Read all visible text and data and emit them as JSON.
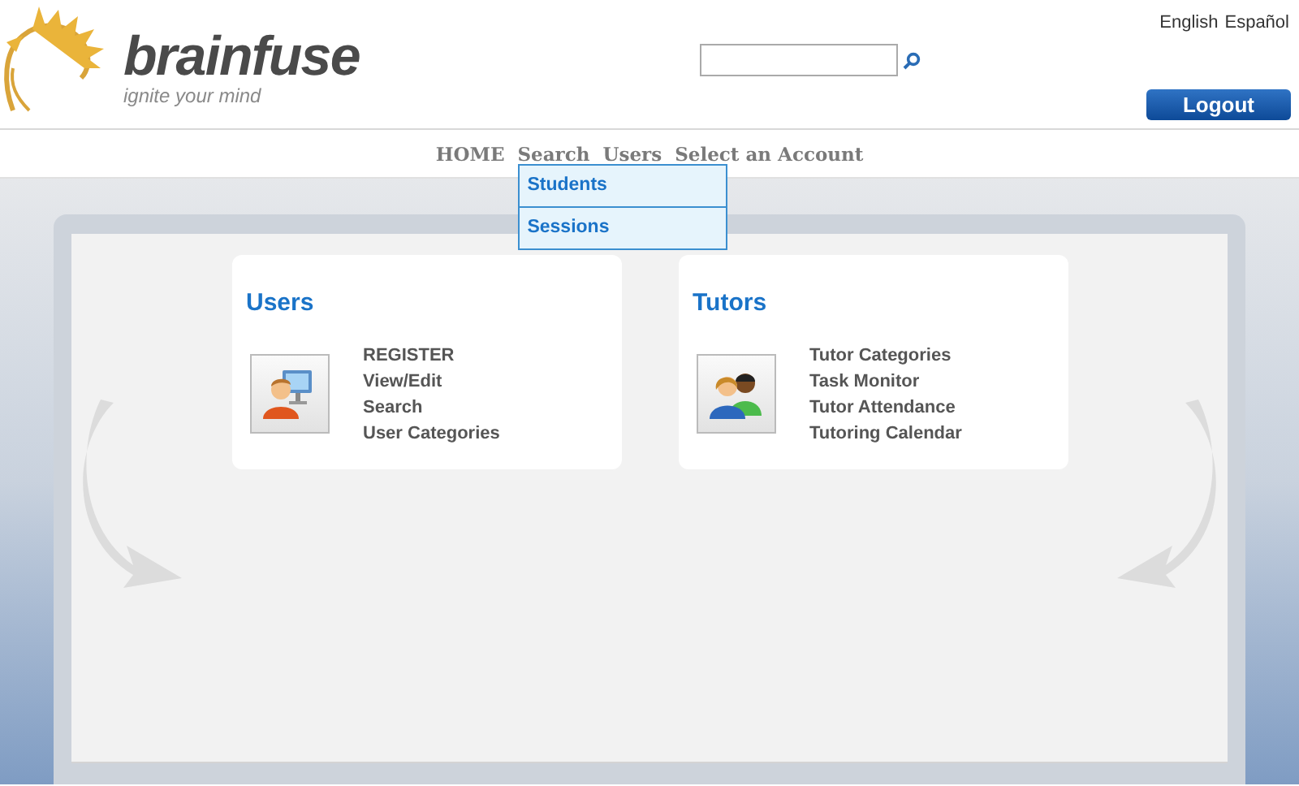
{
  "logo": {
    "name": "brainfuse",
    "tagline": "ignite your mind"
  },
  "languages": [
    "English",
    "Español"
  ],
  "logout_button": "Logout",
  "nav": [
    {
      "label": "HOME"
    },
    {
      "label": "Search",
      "open_menu": [
        "Students",
        "Sessions"
      ]
    },
    {
      "label": "Users"
    },
    {
      "label": "Select an Account"
    }
  ],
  "cards": [
    {
      "title": "Users",
      "kind": "user",
      "links": [
        "REGISTER",
        "View/Edit",
        "Search",
        "User Categories"
      ]
    },
    {
      "title": "Tutors",
      "kind": "tutor",
      "links": [
        "Tutor Categories",
        "Task Monitor",
        "Tutor Attendance",
        "Tutoring Calendar"
      ]
    }
  ]
}
